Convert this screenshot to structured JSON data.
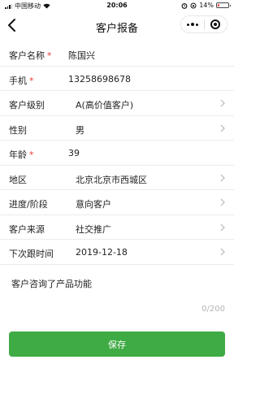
{
  "status_bar": {
    "carrier": "中国移动",
    "time": "20:06",
    "battery": "14%",
    "battery_level": 0.14,
    "battery_color": "#e53935"
  },
  "nav": {
    "title": "客户报备",
    "back_icon": "chevron-left-icon",
    "more_icon": "more-dots-icon",
    "close_icon": "target-circle-icon"
  },
  "form": {
    "name": {
      "label": "客户名称",
      "required_mark": "*",
      "value": "陈国兴"
    },
    "phone": {
      "label": "手机",
      "required_mark": "*",
      "value": "13258698678"
    },
    "level": {
      "label": "客户级别",
      "value": "A(高价值客户)"
    },
    "gender": {
      "label": "性别",
      "value": "男"
    },
    "age": {
      "label": "年龄",
      "required_mark": "*",
      "value": "39"
    },
    "region": {
      "label": "地区",
      "value": "北京北京市西城区"
    },
    "stage": {
      "label": "进度/阶段",
      "value": "意向客户"
    },
    "source": {
      "label": "客户来源",
      "value": "社交推广"
    },
    "next_follow": {
      "label": "下次跟时间",
      "value": "2019-12-18"
    },
    "remark": {
      "value": "客户咨询了产品功能",
      "counter": "0/200"
    }
  },
  "actions": {
    "save_label": "保存",
    "save_color": "#3fab44"
  }
}
